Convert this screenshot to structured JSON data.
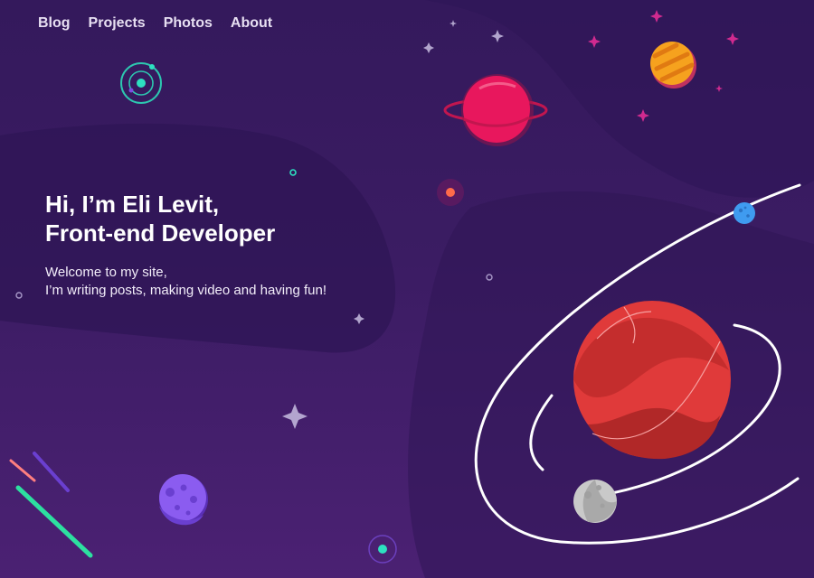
{
  "nav": {
    "items": [
      {
        "label": "Blog"
      },
      {
        "label": "Projects"
      },
      {
        "label": "Photos"
      },
      {
        "label": "About"
      }
    ]
  },
  "hero": {
    "title_line1": "Hi, I’m Eli Levit,",
    "title_line2": "Front-end Developer",
    "subtitle_line1": "Welcome to my site,",
    "subtitle_line2": "I’m writing posts, making video and having fun!"
  },
  "colors": {
    "background_top": "#34195c",
    "background_bottom": "#4b2173",
    "main_planet": "#d93a3a",
    "pink_planet": "#e8175d",
    "orange_planet": "#f6a21e",
    "blue_planet": "#3f9bf0",
    "purple_planet": "#7b4ee0",
    "gray_planet": "#c9c9c9",
    "teal_accent": "#2de0c0"
  },
  "icons": {
    "orbit_logo": "orbit-logo-icon",
    "sparkle": "sparkle-icon"
  }
}
